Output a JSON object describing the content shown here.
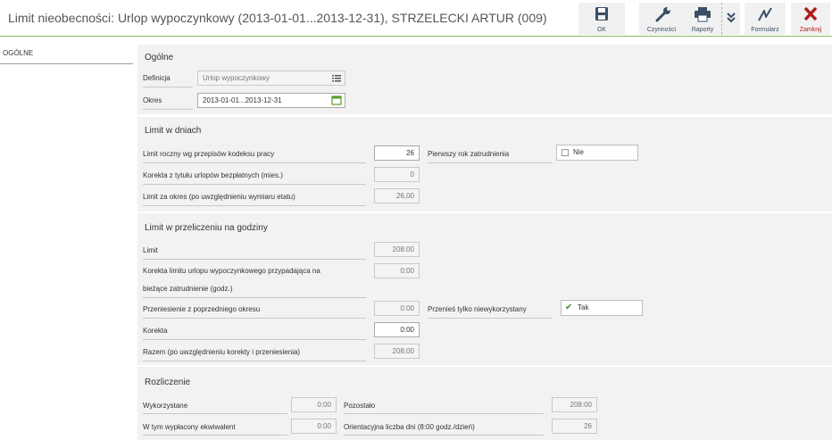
{
  "header": {
    "title": "Limit nieobecności: Urlop wypoczynkowy (2013-01-01...2013-12-31), STRZELECKI ARTUR (009)"
  },
  "toolbar": {
    "ok": "OK",
    "actions": "Czynności",
    "reports": "Raporty",
    "form": "Formularz",
    "close": "Zamknij"
  },
  "sidebar": {
    "tab": "OGÓLNE"
  },
  "general": {
    "title": "Ogólne",
    "definition_label": "Definicja",
    "definition_value": "Urlop wypoczynkowy",
    "period_label": "Okres",
    "period_value": "2013-01-01...2013-12-31"
  },
  "days": {
    "title": "Limit w dniach",
    "annual_label": "Limit roczny wg przepisów kodeksu pracy",
    "annual_value": "26",
    "first_year_label": "Pierwszy rok zatrudnienia",
    "first_year_value": "Nie",
    "correction_label": "Korekta z tytułu urlopów bezpłatnych (mies.)",
    "correction_value": "0",
    "period_limit_label": "Limit za okres (po uwzględnieniu wymiaru etatu)",
    "period_limit_value": "26,00"
  },
  "hours": {
    "title": "Limit w przeliczeniu na godziny",
    "limit_label": "Limit",
    "limit_value": "208:00",
    "corr_line1": "Korekta limitu urlopu wypoczynkowego przypadająca na",
    "corr_line2": "bieżące zatrudnienie (godz.)",
    "corr_value": "0:00",
    "transfer_label": "Przeniesienie z poprzedniego okresu",
    "transfer_value": "0:00",
    "transfer_unused_label": "Przenieś tylko niewykorzystany",
    "transfer_unused_value": "Tak",
    "correction_label": "Korekta",
    "correction_value": "0:00",
    "total_label": "Razem (po uwzględnieniu korekty i przeniesienia)",
    "total_value": "208:00"
  },
  "settlement": {
    "title": "Rozliczenie",
    "used_label": "Wykorzystane",
    "used_value": "0:00",
    "remaining_label": "Pozostało",
    "remaining_value": "208:00",
    "paid_label": "W tym wypłacony ekwiwalent",
    "paid_value": "0:00",
    "days_label": "Orientacyjna liczba dni (8:00 godz./dzień)",
    "days_value": "26"
  }
}
